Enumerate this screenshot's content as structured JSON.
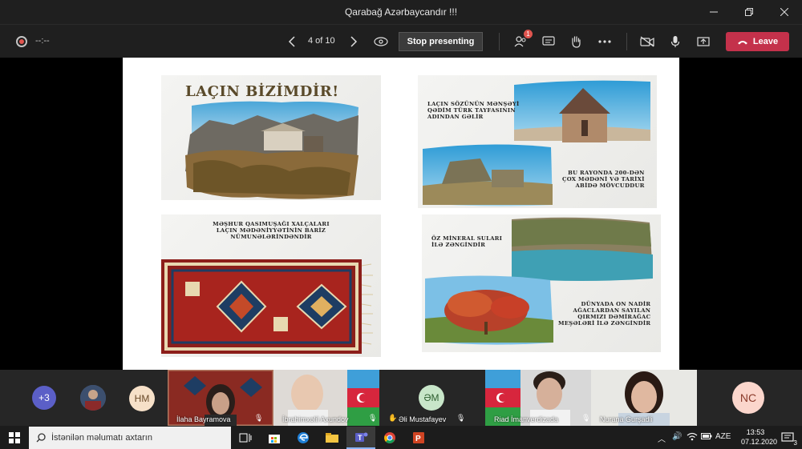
{
  "window": {
    "title": "Qarabağ Azərbaycandır !!!"
  },
  "toolbar": {
    "timer": "--:--",
    "page_indicator": "4 of 10",
    "stop_label": "Stop presenting",
    "participants_badge": "1",
    "leave_label": "Leave"
  },
  "slide": {
    "card1": {
      "title": "LAÇIN BİZİMDİR!"
    },
    "card2": {
      "text1": [
        "LAÇIN SÖZÜNÜN MƏNŞƏYİ",
        "QƏDİM TÜRK TAYFASININ",
        "ADINDAN GƏLİR"
      ],
      "text2": [
        "BU RAYONDA 200-DƏN",
        "ÇOX MƏDƏNİ VƏ TARİXİ",
        "ABİDƏ MÖVCUDDUR"
      ]
    },
    "card3": {
      "text": [
        "MƏŞHUR QASIMUŞAĞI XALÇALARI",
        "LAÇIN MƏDƏNİYYƏTİNİN BARİZ",
        "NÜMUNƏLƏRİNDƏNDİR"
      ]
    },
    "card4": {
      "text1": [
        "ÖZ MİNERAL SULARI",
        "İLƏ ZƏNGİNDİR"
      ],
      "text2": [
        "DÜNYADA ON NADİR",
        "AĞACLARDAN SAYILAN",
        "QIRMIZI DƏMİRAĞAC",
        "MEŞƏLƏRİ İLƏ ZƏNGİNDİR"
      ]
    }
  },
  "participants": {
    "more": "+3",
    "hm_initials": "HM",
    "tile1_name": "İlaha Bayramova",
    "tile2_name": "İbrahimxəlil Axundov",
    "em_initials": "ƏM",
    "tile3_name": "Əli Mustafayev",
    "tile4_name": "Riad İmanverdizada",
    "tile5_name": "Nurana Gurşadli",
    "nc_initials": "NC"
  },
  "taskbar": {
    "search_placeholder": "İstənilən məlumatı axtarın",
    "language": "AZE",
    "time": "13:53",
    "date": "07.12.2020",
    "notif_count": "3"
  },
  "colors": {
    "leave": "#c4314b",
    "accent": "#8ab4f8",
    "avatar_purple": "#5b5fc7"
  }
}
